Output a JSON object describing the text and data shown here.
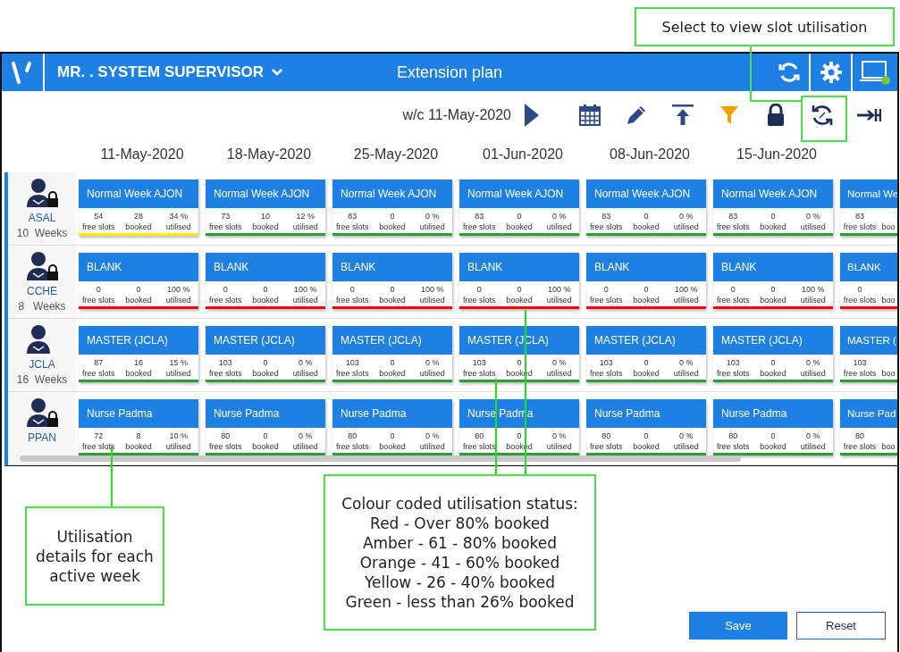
{
  "annotations": [
    {
      "kind": "top",
      "text": "Select to view slot utilisation"
    },
    {
      "kind": "left",
      "text": "Utilisation details for each active week"
    },
    {
      "kind": "legend",
      "text": "Colour coded utilisation status:\nRed - Over 80% booked\nAmber - 61 - 80% booked\nOrange - 41 - 60% booked\nYellow - 26 - 40% booked\nGreen - less than 26% booked"
    }
  ],
  "header": {
    "user": "MR. . SYSTEM SUPERVISOR",
    "title": "Extension plan"
  },
  "toolbar": {
    "week": "w/c 11-May-2020"
  },
  "dates": [
    "11-May-2020",
    "18-May-2020",
    "25-May-2020",
    "01-Jun-2020",
    "08-Jun-2020",
    "15-Jun-2020"
  ],
  "rows": [
    {
      "name": "ASAL",
      "weeks": "10  Weeks",
      "locked": true,
      "cards": [
        {
          "title": "Normal Week AJON",
          "color": "#ffee00",
          "stats": [
            {
              "value": "54",
              "label": "free slots"
            },
            {
              "value": "28",
              "label": "booked"
            },
            {
              "value": "34 %",
              "label": "utilised"
            }
          ]
        },
        {
          "title": "Normal Week AJON",
          "color": "#2e9e2e",
          "stats": [
            {
              "value": "73",
              "label": "free slots"
            },
            {
              "value": "10",
              "label": "booked"
            },
            {
              "value": "12 %",
              "label": "utilised"
            }
          ]
        },
        {
          "title": "Normal Week AJON",
          "color": "#2e9e2e",
          "stats": [
            {
              "value": "83",
              "label": "free slots"
            },
            {
              "value": "0",
              "label": "booked"
            },
            {
              "value": "0 %",
              "label": "utilised"
            }
          ]
        },
        {
          "title": "Normal Week AJON",
          "color": "#2e9e2e",
          "stats": [
            {
              "value": "83",
              "label": "free slots"
            },
            {
              "value": "0",
              "label": "booked"
            },
            {
              "value": "0 %",
              "label": "utilised"
            }
          ]
        },
        {
          "title": "Normal Week AJON",
          "color": "#2e9e2e",
          "stats": [
            {
              "value": "83",
              "label": "free slots"
            },
            {
              "value": "0",
              "label": "booked"
            },
            {
              "value": "0 %",
              "label": "utilised"
            }
          ]
        },
        {
          "title": "Normal Week AJON",
          "color": "#2e9e2e",
          "stats": [
            {
              "value": "83",
              "label": "free slots"
            },
            {
              "value": "0",
              "label": "booked"
            },
            {
              "value": "0 %",
              "label": "utilised"
            }
          ]
        },
        {
          "title": "Normal We",
          "color": "#2e9e2e",
          "stats": [
            {
              "value": "83",
              "label": "free slots"
            },
            {
              "label": "boo"
            }
          ]
        }
      ]
    },
    {
      "name": "CCHE",
      "weeks": "8   Weeks",
      "locked": true,
      "cards": [
        {
          "title": "BLANK",
          "color": "#ff0000",
          "stats": [
            {
              "value": "0",
              "label": "free slots"
            },
            {
              "value": "0",
              "label": "booked"
            },
            {
              "value": "100 %",
              "label": "utilised"
            }
          ]
        },
        {
          "title": "BLANK",
          "color": "#ff0000",
          "stats": [
            {
              "value": "0",
              "label": "free slots"
            },
            {
              "value": "0",
              "label": "booked"
            },
            {
              "value": "100 %",
              "label": "utilised"
            }
          ]
        },
        {
          "title": "BLANK",
          "color": "#ff0000",
          "stats": [
            {
              "value": "0",
              "label": "free slots"
            },
            {
              "value": "0",
              "label": "booked"
            },
            {
              "value": "100 %",
              "label": "utilised"
            }
          ]
        },
        {
          "title": "BLANK",
          "color": "#ff0000",
          "stats": [
            {
              "value": "0",
              "label": "free slots"
            },
            {
              "value": "0",
              "label": "booked"
            },
            {
              "value": "100 %",
              "label": "utilised"
            }
          ]
        },
        {
          "title": "BLANK",
          "color": "#ff0000",
          "stats": [
            {
              "value": "0",
              "label": "free slots"
            },
            {
              "value": "0",
              "label": "booked"
            },
            {
              "value": "100 %",
              "label": "utilised"
            }
          ]
        },
        {
          "title": "BLANK",
          "color": "#ff0000",
          "stats": [
            {
              "value": "0",
              "label": "free slots"
            },
            {
              "value": "0",
              "label": "booked"
            },
            {
              "value": "100 %",
              "label": "utilised"
            }
          ]
        },
        {
          "title": "BLANK",
          "color": "#ff0000",
          "stats": [
            {
              "value": "0",
              "label": "free slots"
            },
            {
              "label": "boo"
            }
          ]
        }
      ]
    },
    {
      "name": "JCLA",
      "weeks": "16  Weeks",
      "locked": false,
      "cards": [
        {
          "title": "MASTER (JCLA)",
          "color": "#2e9e2e",
          "stats": [
            {
              "value": "87",
              "label": "free slots"
            },
            {
              "value": "16",
              "label": "booked"
            },
            {
              "value": "15 %",
              "label": "utilised"
            }
          ]
        },
        {
          "title": "MASTER (JCLA)",
          "color": "#2e9e2e",
          "stats": [
            {
              "value": "103",
              "label": "free slots"
            },
            {
              "value": "0",
              "label": "booked"
            },
            {
              "value": "0 %",
              "label": "utilised"
            }
          ]
        },
        {
          "title": "MASTER (JCLA)",
          "color": "#2e9e2e",
          "stats": [
            {
              "value": "103",
              "label": "free slots"
            },
            {
              "value": "0",
              "label": "booked"
            },
            {
              "value": "0 %",
              "label": "utilised"
            }
          ]
        },
        {
          "title": "MASTER (JCLA)",
          "color": "#2e9e2e",
          "stats": [
            {
              "value": "103",
              "label": "free slots"
            },
            {
              "value": "0",
              "label": "booked"
            },
            {
              "value": "0 %",
              "label": "utilised"
            }
          ]
        },
        {
          "title": "MASTER (JCLA)",
          "color": "#2e9e2e",
          "stats": [
            {
              "value": "103",
              "label": "free slots"
            },
            {
              "value": "0",
              "label": "booked"
            },
            {
              "value": "0 %",
              "label": "utilised"
            }
          ]
        },
        {
          "title": "MASTER (JCLA)",
          "color": "#2e9e2e",
          "stats": [
            {
              "value": "103",
              "label": "free slots"
            },
            {
              "value": "0",
              "label": "booked"
            },
            {
              "value": "0 %",
              "label": "utilised"
            }
          ]
        },
        {
          "title": "MASTER (",
          "color": "#2e9e2e",
          "stats": [
            {
              "value": "103",
              "label": "free slots"
            },
            {
              "label": "boo"
            }
          ]
        }
      ]
    },
    {
      "name": "PPAN",
      "locked": true,
      "cards": [
        {
          "title": "Nurse Padma",
          "color": "#2e9e2e",
          "stats": [
            {
              "value": "72",
              "label": "free slots"
            },
            {
              "value": "8",
              "label": "booked"
            },
            {
              "value": "10 %",
              "label": "utilised"
            }
          ]
        },
        {
          "title": "Nurse Padma",
          "color": "#2e9e2e",
          "stats": [
            {
              "value": "80",
              "label": "free slots"
            },
            {
              "value": "0",
              "label": "booked"
            },
            {
              "value": "0 %",
              "label": "utilised"
            }
          ]
        },
        {
          "title": "Nurse Padma",
          "color": "#2e9e2e",
          "stats": [
            {
              "value": "80",
              "label": "free slots"
            },
            {
              "value": "0",
              "label": "booked"
            },
            {
              "value": "0 %",
              "label": "utilised"
            }
          ]
        },
        {
          "title": "Nurse Padma",
          "color": "#2e9e2e",
          "stats": [
            {
              "value": "80",
              "label": "free slots"
            },
            {
              "value": "0",
              "label": "booked"
            },
            {
              "value": "0 %",
              "label": "utilised"
            }
          ]
        },
        {
          "title": "Nurse Padma",
          "color": "#2e9e2e",
          "stats": [
            {
              "value": "80",
              "label": "free slots"
            },
            {
              "value": "0",
              "label": "booked"
            },
            {
              "value": "0 %",
              "label": "utilised"
            }
          ]
        },
        {
          "title": "Nurse Padma",
          "color": "#2e9e2e",
          "stats": [
            {
              "value": "80",
              "label": "free slots"
            },
            {
              "value": "0",
              "label": "booked"
            },
            {
              "value": "0 %",
              "label": "utilised"
            }
          ]
        },
        {
          "title": "Nurse Pad",
          "color": "#2e9e2e",
          "stats": [
            {
              "value": "80",
              "label": "free slots"
            },
            {
              "label": "boo"
            }
          ]
        }
      ]
    }
  ],
  "buttons": [
    {
      "kind": "primary",
      "label": "Save"
    },
    {
      "kind": "secondary",
      "label": "Reset"
    }
  ]
}
